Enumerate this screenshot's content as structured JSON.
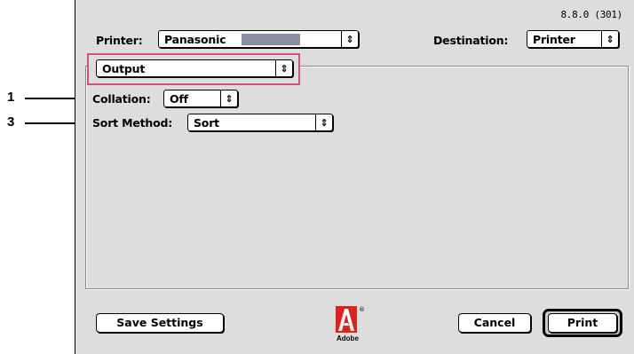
{
  "version": "8.8.0 (301)",
  "printer": {
    "label": "Printer:",
    "value": "Panasonic"
  },
  "destination": {
    "label": "Destination:",
    "value": "Printer"
  },
  "panel_menu": {
    "value": "Output"
  },
  "collation": {
    "label": "Collation:",
    "value": "Off"
  },
  "sort_method": {
    "label": "Sort Method:",
    "value": "Sort"
  },
  "callouts": [
    "1",
    "3"
  ],
  "buttons": {
    "save_settings": "Save Settings",
    "cancel": "Cancel",
    "print": "Print"
  },
  "logo": {
    "text": "Adobe",
    "registered": "®"
  },
  "colors": {
    "highlight": "#d64f7c",
    "redacted": "#8c8fa3",
    "dialog_bg": "#dddddd"
  }
}
